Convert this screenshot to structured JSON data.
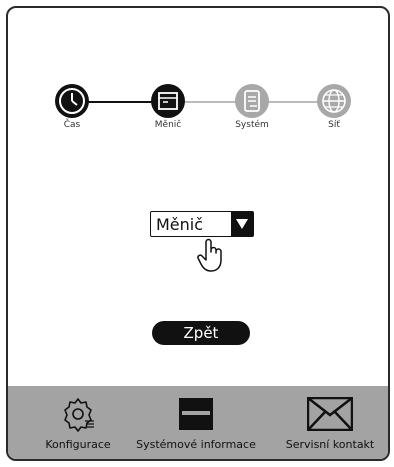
{
  "steps": [
    {
      "label": "Čas",
      "icon": "clock-icon",
      "state": "active"
    },
    {
      "label": "Měnič",
      "icon": "inverter-icon",
      "state": "active"
    },
    {
      "label": "Systém",
      "icon": "system-icon",
      "state": "inactive"
    },
    {
      "label": "Síť",
      "icon": "globe-icon",
      "state": "inactive"
    }
  ],
  "selector": {
    "value": "Měnič"
  },
  "back_button": {
    "label": "Zpět"
  },
  "bottom_bar": {
    "items": [
      {
        "label": "Konfigurace",
        "icon": "gear-icon"
      },
      {
        "label": "Systémové informace",
        "icon": "info-icon"
      },
      {
        "label": "Servisní kontakt",
        "icon": "envelope-icon"
      }
    ]
  },
  "colors": {
    "active": "#111111",
    "inactive": "#a8a8a8",
    "bar": "#a3a3a3"
  }
}
